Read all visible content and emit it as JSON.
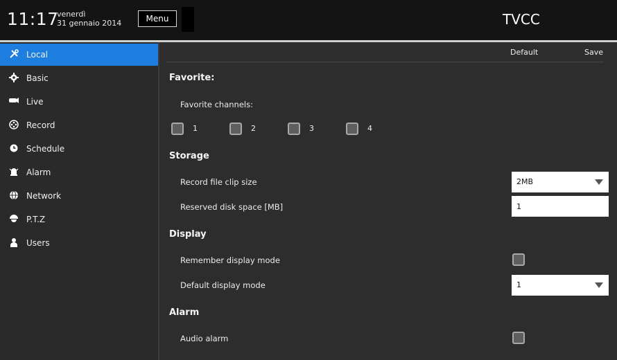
{
  "header": {
    "time": "11:17",
    "weekday": "venerdì",
    "date": "31 gennaio 2014",
    "menu_label": "Menu",
    "app_title": "TVCC"
  },
  "colors": {
    "accent": "#1d7ee0",
    "background": "#2c2c2c",
    "topbar": "#141414"
  },
  "sidebar": {
    "items": [
      {
        "label": "Local",
        "icon": "tools-icon",
        "active": true
      },
      {
        "label": "Basic",
        "icon": "gear-icon",
        "active": false
      },
      {
        "label": "Live",
        "icon": "camera-icon",
        "active": false
      },
      {
        "label": "Record",
        "icon": "film-reel-icon",
        "active": false
      },
      {
        "label": "Schedule",
        "icon": "clock-gear-icon",
        "active": false
      },
      {
        "label": "Alarm",
        "icon": "alarm-icon",
        "active": false
      },
      {
        "label": "Network",
        "icon": "globe-icon",
        "active": false
      },
      {
        "label": "P.T.Z",
        "icon": "dome-camera-icon",
        "active": false
      },
      {
        "label": "Users",
        "icon": "user-icon",
        "active": false
      }
    ]
  },
  "actions": {
    "default_label": "Default",
    "save_label": "Save"
  },
  "favorite": {
    "title": "Favorite:",
    "channels_label": "Favorite channels:",
    "channels": [
      {
        "number": "1",
        "checked": false
      },
      {
        "number": "2",
        "checked": false
      },
      {
        "number": "3",
        "checked": false
      },
      {
        "number": "4",
        "checked": false
      }
    ]
  },
  "storage": {
    "title": "Storage",
    "clip_size_label": "Record file clip size",
    "clip_size_value": "2MB",
    "reserved_label": "Reserved disk space [MB]",
    "reserved_value": "1"
  },
  "display": {
    "title": "Display",
    "remember_label": "Remember display mode",
    "remember_checked": false,
    "default_mode_label": "Default display mode",
    "default_mode_value": "1"
  },
  "alarm": {
    "title": "Alarm",
    "audio_label": "Audio alarm",
    "audio_checked": false
  }
}
